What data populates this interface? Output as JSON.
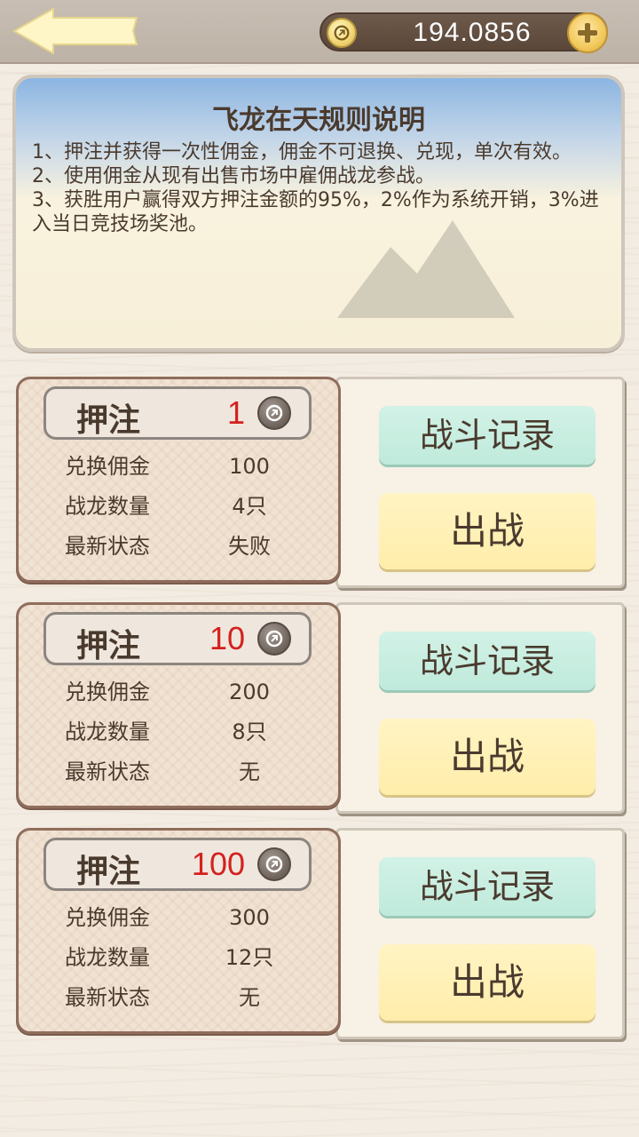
{
  "header": {
    "balance": "194.0856",
    "back_icon": "back-arrow-icon",
    "coin_icon": "coin-icon",
    "plus_icon": "plus-icon"
  },
  "rules": {
    "title": "飞龙在天规则说明",
    "lines": [
      "1、押注并获得一次性佣金，佣金不可退换、兑现，单次有效。",
      " 2、使用佣金从现有出售市场中雇佣战龙参战。",
      " 3、获胜用户赢得双方押注金额的95%，2%作为系统开销，3%进入当日竞技场奖池。"
    ]
  },
  "labels": {
    "bet": "押注",
    "commission": "兑换佣金",
    "dragons": "战龙数量",
    "status": "最新状态",
    "record_button": "战斗记录",
    "fight_button": "出战"
  },
  "bets": [
    {
      "amount": "1",
      "commission": "100",
      "dragons": "4只",
      "status": "失败"
    },
    {
      "amount": "10",
      "commission": "200",
      "dragons": "8只",
      "status": "无"
    },
    {
      "amount": "100",
      "commission": "300",
      "dragons": "12只",
      "status": "无"
    }
  ],
  "colors": {
    "bet_amount": "#d3211f",
    "record_button": "#c8eee0",
    "fight_button": "#fff0b5"
  }
}
